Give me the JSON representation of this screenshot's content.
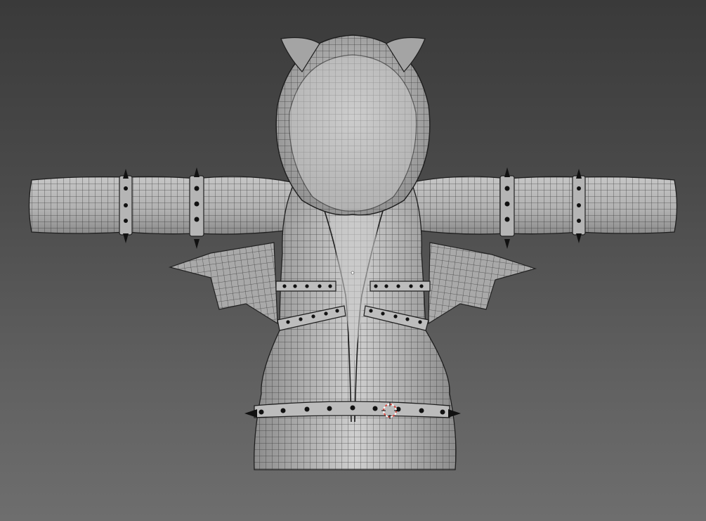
{
  "viewport": {
    "background_top": "#3a3a3a",
    "background_bottom": "#6e6e6e",
    "mode": "wireframe-overlay"
  },
  "model": {
    "name": "hoodie-with-cat-ears-and-bat-wings",
    "mesh_color": "#b7b7b7",
    "wire_color": "#1f1f1f",
    "stud_color": "#111111",
    "parts": [
      "hood",
      "cat-ears",
      "left-sleeve",
      "right-sleeve",
      "torso",
      "bat-wings",
      "chest-straps",
      "waist-belt",
      "sleeve-bands"
    ]
  },
  "cursor_3d": {
    "icon": "3d-cursor-icon",
    "color_a": "#d9473f",
    "color_b": "#ffffff"
  }
}
